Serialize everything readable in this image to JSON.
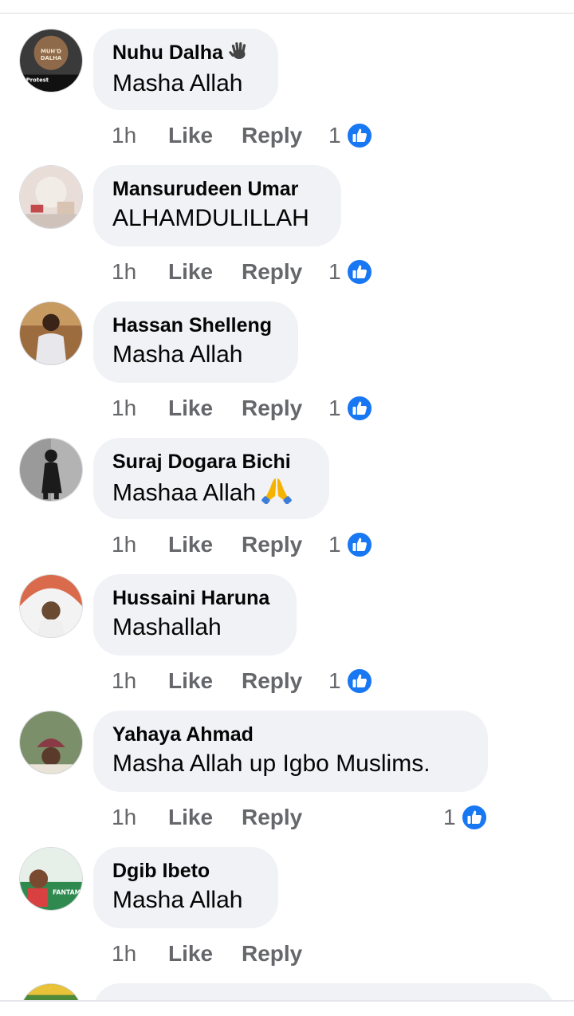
{
  "comments": [
    {
      "author": "Nuhu Dalha",
      "author_emoji": "wave-hand",
      "text": "Masha Allah",
      "time": "1h",
      "like_label": "Like",
      "reply_label": "Reply",
      "reactions": "1",
      "avatar": {
        "bg": "#3b3a3a",
        "accent": "#8f6a4a",
        "label_top": "MUH'D DALHA",
        "label_bottom": "Protest"
      }
    },
    {
      "author": "Mansurudeen Umar",
      "text": "ALHAMDULILLAH",
      "time": "1h",
      "like_label": "Like",
      "reply_label": "Reply",
      "reactions": "1",
      "avatar": {
        "bg": "#e9ddd8",
        "accent": "#c34a4a"
      }
    },
    {
      "author": "Hassan Shelleng",
      "text": "Masha Allah",
      "time": "1h",
      "like_label": "Like",
      "reply_label": "Reply",
      "reactions": "1",
      "avatar": {
        "bg": "#9c6b3e",
        "accent": "#e8e8ec"
      }
    },
    {
      "author": "Suraj Dogara Bichi",
      "text": "Mashaa Allah",
      "text_emoji": "folded-hands",
      "time": "1h",
      "like_label": "Like",
      "reply_label": "Reply",
      "reactions": "1",
      "avatar": {
        "bg": "#b3b3b3",
        "accent": "#1b1b1b"
      }
    },
    {
      "author": "Hussaini Haruna",
      "text": "Mashallah",
      "time": "1h",
      "like_label": "Like",
      "reply_label": "Reply",
      "reactions": "1",
      "avatar": {
        "bg": "#d96a4b",
        "accent": "#efefef"
      }
    },
    {
      "author": "Yahaya Ahmad",
      "text": "Masha Allah up Igbo Muslims.",
      "time": "1h",
      "like_label": "Like",
      "reply_label": "Reply",
      "reactions": "1",
      "avatar": {
        "bg": "#7b8f6a",
        "accent": "#8a3a45"
      }
    },
    {
      "author": "Dgib Ibeto",
      "text": "Masha Allah",
      "time": "1h",
      "like_label": "Like",
      "reply_label": "Reply",
      "reactions": "",
      "avatar": {
        "bg": "#5a8f6a",
        "accent": "#d94040",
        "label_top": "FANTAMI"
      }
    }
  ],
  "colors": {
    "like_blue": "#1877f2",
    "muted": "#65676b",
    "bubble": "#f0f2f5"
  }
}
